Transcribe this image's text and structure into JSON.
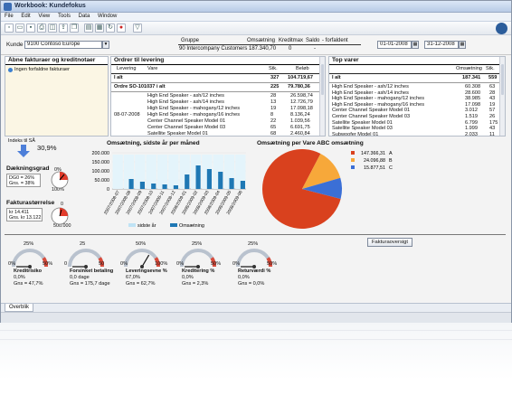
{
  "window": {
    "title": "Workbook: Kundefokus"
  },
  "menu": [
    "File",
    "Edit",
    "View",
    "Tools",
    "Data",
    "Window"
  ],
  "filters": {
    "kunde_label": "Kunde",
    "kunde_value": "9100 Contoso Europe",
    "date_from": "01-01-2008",
    "date_to": "31-12-2008"
  },
  "summary": {
    "headers": [
      "Gruppe",
      "Omsætning",
      "Kreditmax",
      "Saldo",
      "- forfaldent"
    ],
    "row": [
      "90 Intercompany Customers",
      "187.340,70",
      "0",
      "-",
      ""
    ]
  },
  "open_invoices": {
    "title": "Åbne fakturaer og kreditnotaer",
    "empty_text": "Ingen forfaldne fakturaer"
  },
  "orders": {
    "title": "Ordrer til levering",
    "headers": [
      "Levering",
      "Vare",
      "Stk.",
      "Beløb"
    ],
    "total_label": "I alt",
    "total_qty": "327",
    "total_amount": "104.719,67",
    "order_label": "Ordre SO-101037 i alt",
    "order_qty": "225",
    "order_amount": "79.780,36",
    "rows": [
      {
        "date": "",
        "item": "High End Speaker - ash/12 inches",
        "qty": "28",
        "amount": "26.598,74"
      },
      {
        "date": "",
        "item": "High End Speaker - ash/14 inches",
        "qty": "13",
        "amount": "12.726,79"
      },
      {
        "date": "",
        "item": "High End Speaker - mahogany/12 inches",
        "qty": "19",
        "amount": "17.098,18"
      },
      {
        "date": "08-07-2008",
        "item": "High End Speaker - mahogany/16 inches",
        "qty": "8",
        "amount": "8.136,24"
      },
      {
        "date": "",
        "item": "Center Channel Speaker Model 01",
        "qty": "22",
        "amount": "1.039,56"
      },
      {
        "date": "",
        "item": "Center Channel Speaker Model 03",
        "qty": "65",
        "amount": "6.691,75"
      },
      {
        "date": "",
        "item": "Satellite Speaker Model 01",
        "qty": "68",
        "amount": "2.460,84"
      }
    ]
  },
  "top_items": {
    "title": "Top varer",
    "headers": [
      "Omsætning",
      "Stk."
    ],
    "total_label": "I alt",
    "total_amount": "187.341",
    "total_qty": "559",
    "rows": [
      {
        "item": "High End Speaker - ash/12 inches",
        "amount": "60.308",
        "qty": "63"
      },
      {
        "item": "High End Speaker - ash/14 inches",
        "amount": "28.600",
        "qty": "28"
      },
      {
        "item": "High End Speaker - mahogany/12 inches",
        "amount": "38.985",
        "qty": "43"
      },
      {
        "item": "High End Speaker - mahogany/16 inches",
        "amount": "17.098",
        "qty": "19"
      },
      {
        "item": "Center Channel Speaker Model 01",
        "amount": "3.012",
        "qty": "57"
      },
      {
        "item": "Center Channel Speaker Model 03",
        "amount": "1.519",
        "qty": "26"
      },
      {
        "item": "Satellite Speaker Model 01",
        "amount": "6.799",
        "qty": "175"
      },
      {
        "item": "Satellite Speaker Model 03",
        "amount": "1.999",
        "qty": "43"
      },
      {
        "item": "Subwoofer Model 01",
        "amount": "2.033",
        "qty": "11"
      }
    ]
  },
  "index": {
    "label": "Indeks til SÅ",
    "value": "30,9%"
  },
  "coverage": {
    "title": "Dækningsgrad",
    "legend": [
      "DG0 = 26%",
      "Gns. = 38%"
    ],
    "scale_min": "0%",
    "scale_max": "100%"
  },
  "invoice_size": {
    "title": "Fakturastørrelse",
    "legend": [
      "kr 14.411",
      "Gns. kr 13.122"
    ],
    "scale_min": "0",
    "scale_max": "500.000"
  },
  "chart_data": [
    {
      "type": "bar",
      "title": "Omsætning, sidste år per måned",
      "categories": [
        "2007/2008-07",
        "2007/2008-08",
        "2007/2008-09",
        "2007/2008-10",
        "2007/2008-11",
        "2007/2008-12",
        "2008/2009-01",
        "2008/2009-02",
        "2008/2009-03",
        "2008/2009-04",
        "2008/2009-05",
        "2008/2009-06"
      ],
      "ylim": [
        0,
        200000
      ],
      "yticks": [
        "200.000",
        "150.000",
        "100.000",
        "50.000",
        "0"
      ],
      "series": [
        {
          "name": "sidste år",
          "color": "#bfe3f5",
          "values": [
            0,
            0,
            0,
            0,
            0,
            0,
            0,
            0,
            0,
            0,
            0,
            0
          ]
        },
        {
          "name": "Omsætning",
          "color": "#1f78b4",
          "values": [
            0,
            55000,
            40000,
            30000,
            25000,
            20000,
            80000,
            130000,
            110000,
            95000,
            60000,
            45000
          ]
        }
      ],
      "legend": [
        "sidste år",
        "Omsætning"
      ]
    },
    {
      "type": "pie",
      "title": "Omsætning per Vare ABC omsætning",
      "slices": [
        {
          "label": "A",
          "value": 147366.31,
          "display": "147.366,31",
          "color": "#d9411e"
        },
        {
          "label": "B",
          "value": 24096.88,
          "display": "24.096,88",
          "color": "#f7a83a"
        },
        {
          "label": "C",
          "value": 15877.51,
          "display": "15.877,51",
          "color": "#3b6fd6"
        }
      ]
    }
  ],
  "gauges_button": "Fakturaoversigt",
  "gauges": [
    {
      "label": "Kreditrisiko",
      "value": "0,0%",
      "avg": "Gns = 47,7%",
      "min": "0%",
      "mid": "25%",
      "max": "50%",
      "needle": 0.0
    },
    {
      "label": "Forsinket betaling",
      "value": "0,0 dage",
      "avg": "Gns = 175,7 dage",
      "min": "0",
      "mid": "25",
      "max": "50",
      "needle": 0.0
    },
    {
      "label": "Leveringsevne %",
      "value": "67,0%",
      "avg": "Gns = 62,7%",
      "min": "0%",
      "mid": "50%",
      "max": "100%",
      "needle": 0.67
    },
    {
      "label": "Kreditering %",
      "value": "0,0%",
      "avg": "Gns = 2,3%",
      "min": "0%",
      "mid": "25%",
      "max": "50%",
      "needle": 0.0
    },
    {
      "label": "Returværdi %",
      "value": "0,0%",
      "avg": "Gns = 0,0%",
      "min": "0%",
      "mid": "25%",
      "max": "50%",
      "needle": 0.0
    }
  ],
  "tabs": [
    "Overblik"
  ]
}
